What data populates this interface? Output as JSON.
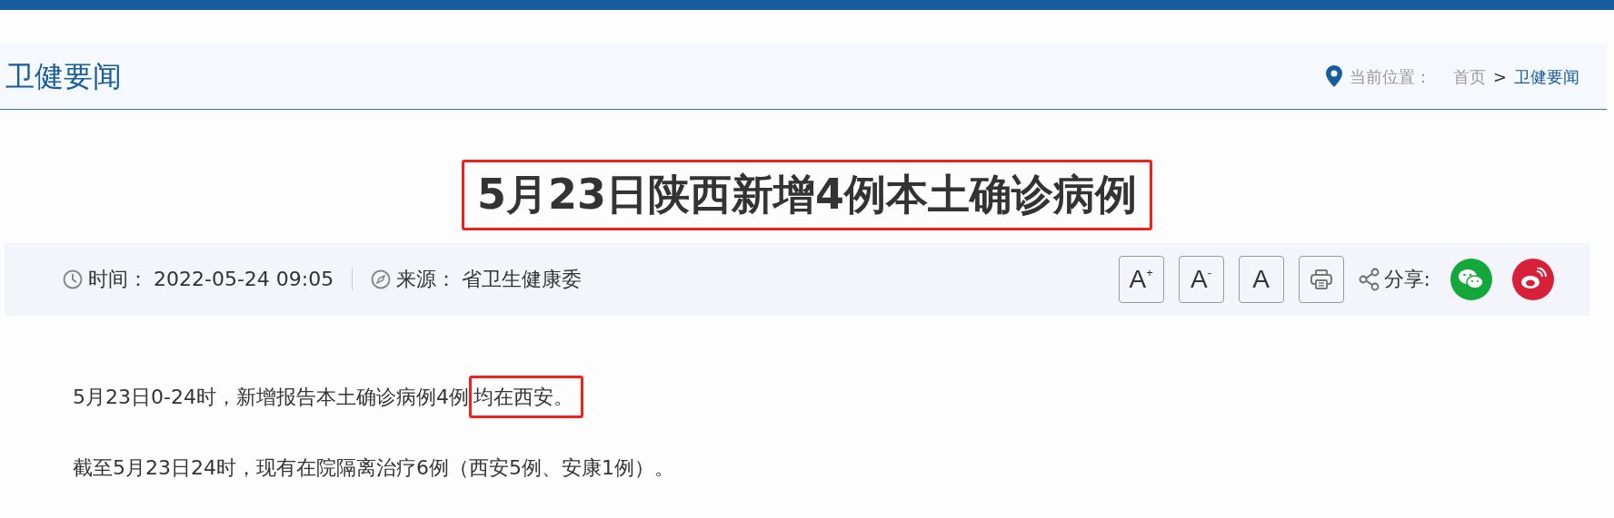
{
  "section": {
    "title": "卫健要闻"
  },
  "breadcrumb": {
    "label": "当前位置：",
    "items": [
      {
        "text": "首页",
        "selected": false
      },
      {
        "text": "卫健要闻",
        "selected": true
      }
    ],
    "separator": ">"
  },
  "article": {
    "title": "5月23日陕西新增4例本土确诊病例",
    "title_highlighted": true,
    "meta": {
      "time_label": "时间：",
      "time": "2022-05-24 09:05",
      "source_label": "来源：",
      "source": "省卫生健康委"
    },
    "tools": [
      {
        "kind": "font-larger",
        "text": "A",
        "sup": "+"
      },
      {
        "kind": "font-smaller",
        "text": "A",
        "sup": "-"
      },
      {
        "kind": "font-reset",
        "text": "A"
      },
      {
        "kind": "print"
      }
    ],
    "share_label": "分享:",
    "share": [
      {
        "kind": "wechat",
        "color": "#14a83b"
      },
      {
        "kind": "weibo",
        "color": "#d7213a"
      }
    ],
    "paragraphs": [
      {
        "text": "5月23日0-24时，新增报告本土确诊病例4例",
        "highlight": "均在西安。"
      },
      {
        "text": "截至5月23日24时，现有在院隔离治疗6例（西安5例、安康1例）。"
      }
    ]
  }
}
